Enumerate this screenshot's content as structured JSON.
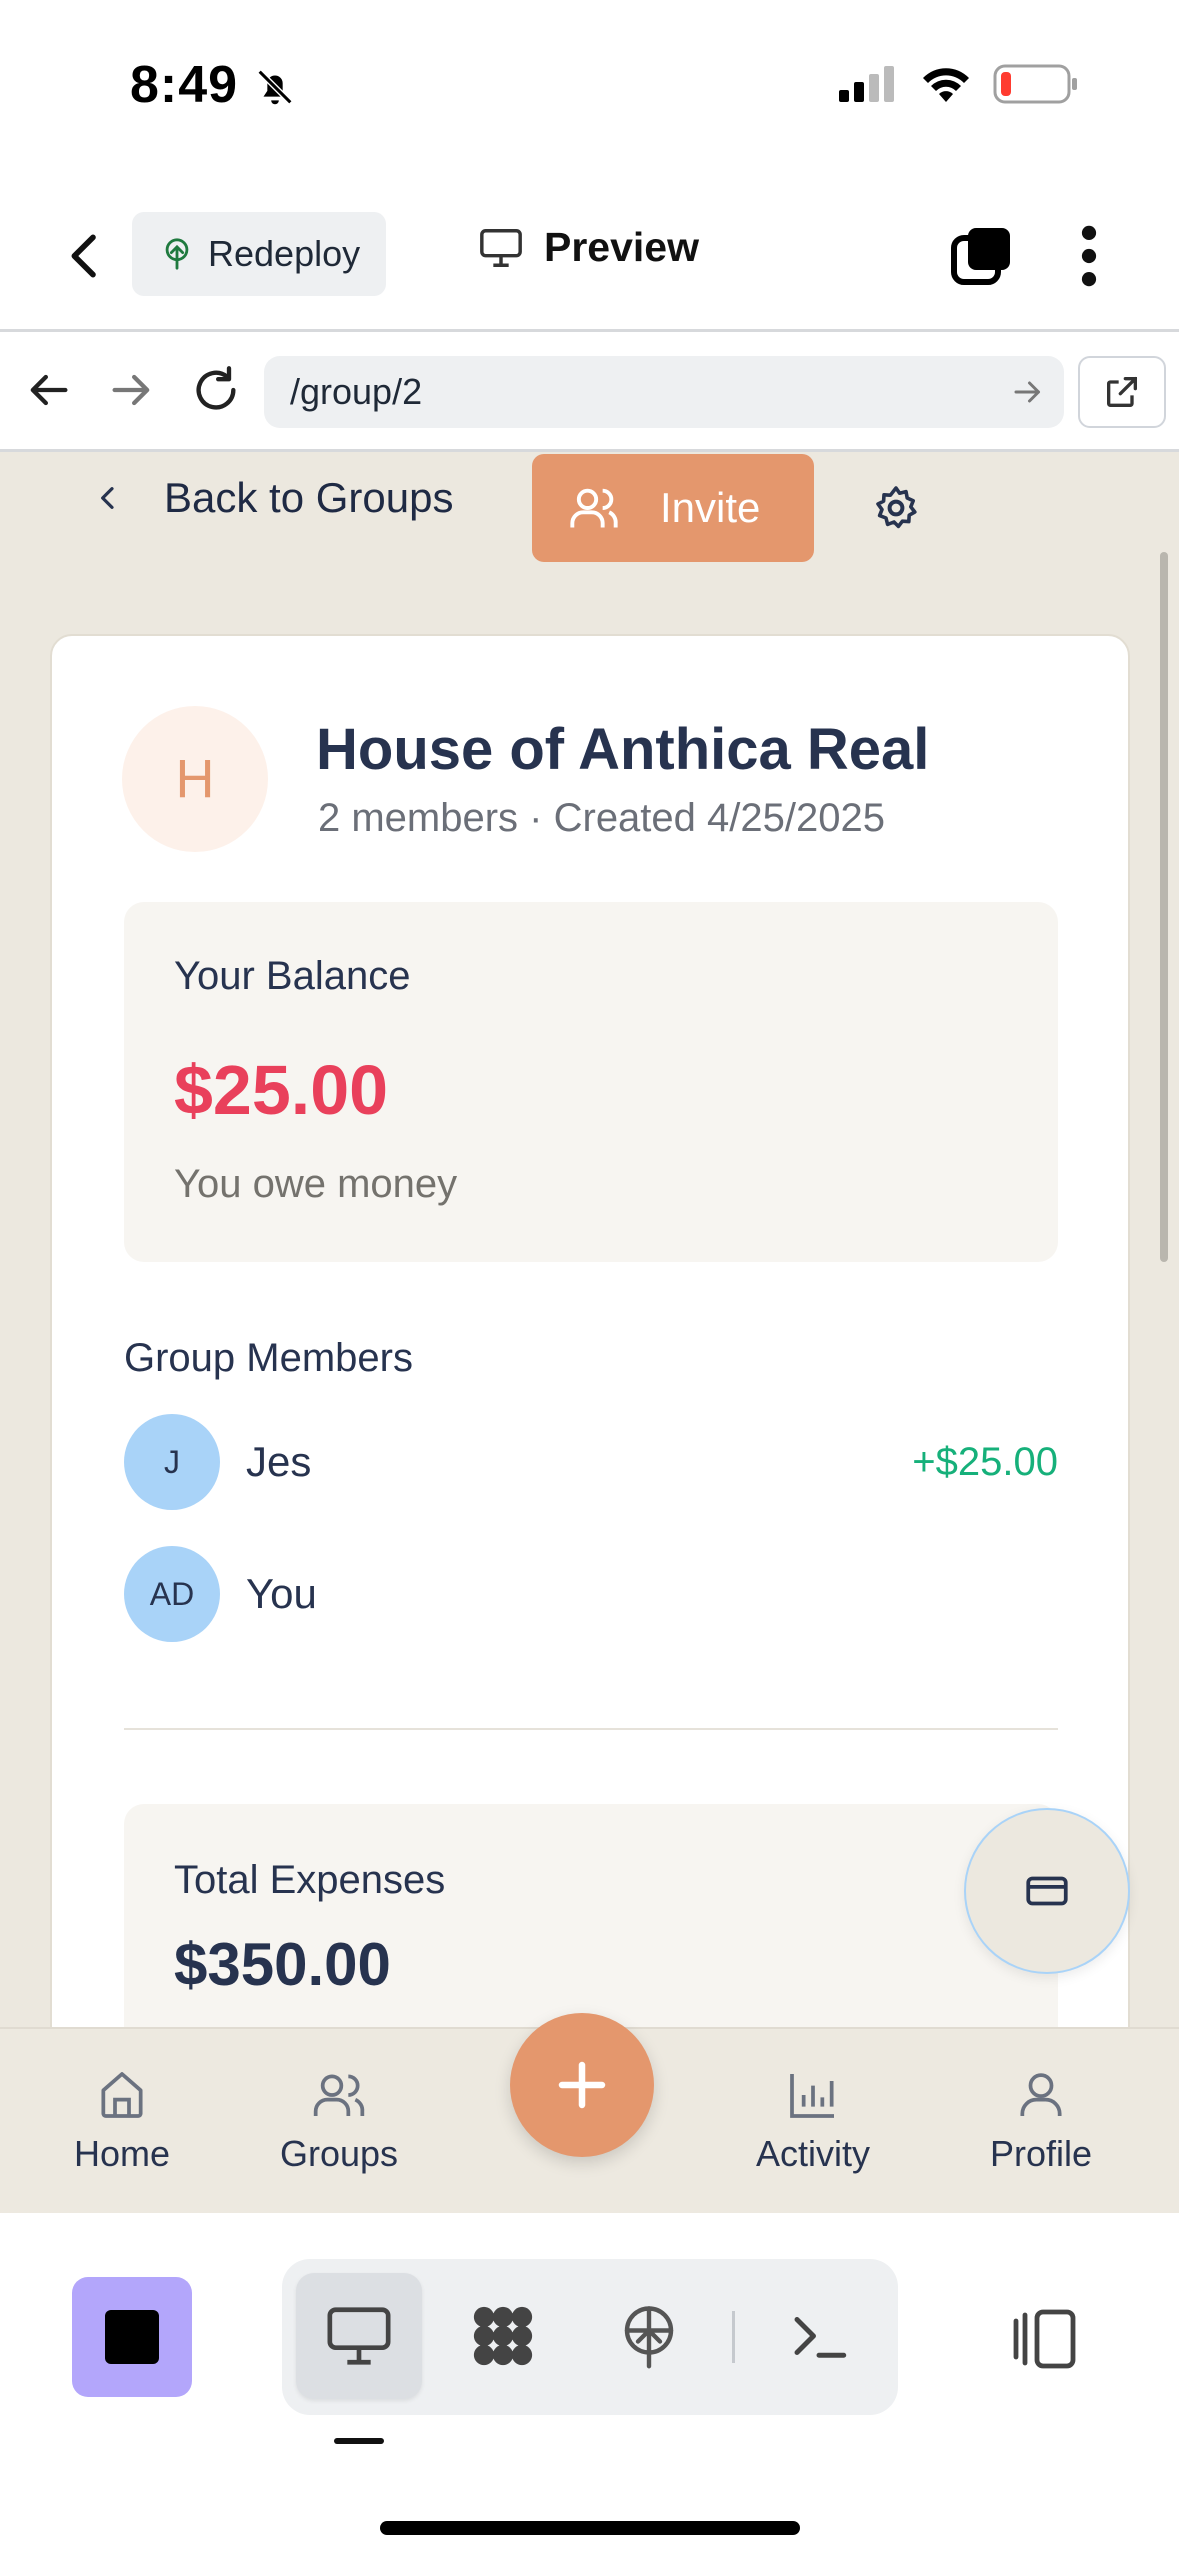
{
  "status_bar": {
    "time": "8:49"
  },
  "app_bar": {
    "redeploy_label": "Redeploy",
    "preview_label": "Preview"
  },
  "browser": {
    "url": "/group/2"
  },
  "group_header": {
    "back_label": "Back to Groups",
    "invite_label": "Invite"
  },
  "group": {
    "initial": "H",
    "name": "House of Anthica Real",
    "subtitle": "2 members · Created 4/25/2025"
  },
  "balance": {
    "label": "Your Balance",
    "amount": "$25.00",
    "note": "You owe money",
    "amount_color": "#e9405b"
  },
  "members": {
    "title": "Group Members",
    "items": [
      {
        "initials": "J",
        "name": "Jes",
        "amount": "+$25.00"
      },
      {
        "initials": "AD",
        "name": "You",
        "amount": ""
      }
    ]
  },
  "expenses": {
    "label": "Total Expenses",
    "amount": "$350.00"
  },
  "bottom_nav": {
    "items": [
      {
        "label": "Home",
        "icon": "home-icon"
      },
      {
        "label": "Groups",
        "icon": "users-icon"
      },
      {
        "label": "Activity",
        "icon": "bar-chart-icon"
      },
      {
        "label": "Profile",
        "icon": "user-icon"
      }
    ]
  },
  "colors": {
    "accent": "#e4976d",
    "background": "#ece8df",
    "positive": "#16b07a",
    "negative": "#e9405b",
    "avatar": "#a9d3f8"
  }
}
